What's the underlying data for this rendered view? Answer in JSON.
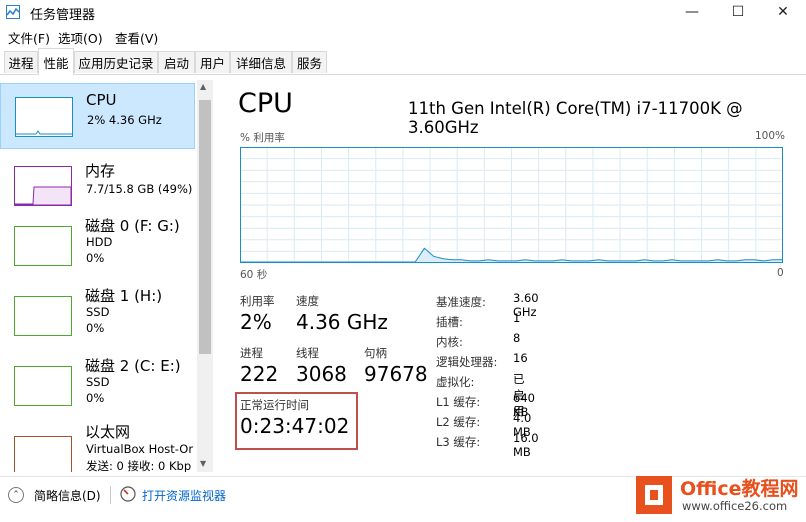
{
  "window": {
    "title": "任务管理器"
  },
  "menu": {
    "file": "文件(F)",
    "options": "选项(O)",
    "view": "查看(V)"
  },
  "tabs": [
    {
      "label": "进程"
    },
    {
      "label": "性能"
    },
    {
      "label": "应用历史记录"
    },
    {
      "label": "启动"
    },
    {
      "label": "用户"
    },
    {
      "label": "详细信息"
    },
    {
      "label": "服务"
    }
  ],
  "sidebar": {
    "items": [
      {
        "title": "CPU",
        "line1": "2% 4.36 GHz",
        "line2": ""
      },
      {
        "title": "内存",
        "line1": "7.7/15.8 GB (49%)",
        "line2": ""
      },
      {
        "title": "磁盘 0 (F: G:)",
        "line1": "HDD",
        "line2": "0%"
      },
      {
        "title": "磁盘 1 (H:)",
        "line1": "SSD",
        "line2": "0%"
      },
      {
        "title": "磁盘 2 (C: E:)",
        "line1": "SSD",
        "line2": "0%"
      },
      {
        "title": "以太网",
        "line1": "VirtualBox Host-Or",
        "line2": "发送: 0 接收: 0 Kbp"
      }
    ]
  },
  "main": {
    "title": "CPU",
    "model": "11th Gen Intel(R) Core(TM) i7-11700K @ 3.60GHz",
    "graph": {
      "ylabel": "% 利用率",
      "ymax": "100%",
      "xleft": "60 秒",
      "xright": "0",
      "utilization_pct": [
        0,
        0,
        0,
        0,
        0,
        0,
        0,
        0,
        0,
        0,
        0,
        0,
        0,
        0,
        0,
        0,
        0,
        0,
        0,
        0,
        0,
        0,
        0,
        0,
        0,
        0,
        0,
        0,
        0,
        0,
        0,
        0,
        0,
        0,
        0,
        0,
        0,
        0,
        0,
        0,
        0,
        0,
        0,
        0,
        0,
        0,
        0,
        0,
        0,
        0,
        0,
        0,
        0,
        0,
        0,
        0,
        0,
        0,
        0,
        0
      ]
    },
    "stats": {
      "util_label": "利用率",
      "util_value": "2%",
      "speed_label": "速度",
      "speed_value": "4.36 GHz",
      "proc_label": "进程",
      "proc_value": "222",
      "thread_label": "线程",
      "thread_value": "3068",
      "handle_label": "句柄",
      "handle_value": "97678",
      "uptime_label": "正常运行时间",
      "uptime_value": "0:23:47:02"
    },
    "details": [
      {
        "k": "基准速度:",
        "v": "3.60 GHz"
      },
      {
        "k": "插槽:",
        "v": "1"
      },
      {
        "k": "内核:",
        "v": "8"
      },
      {
        "k": "逻辑处理器:",
        "v": "16"
      },
      {
        "k": "虚拟化:",
        "v": "已启用"
      },
      {
        "k": "L1 缓存:",
        "v": "640 KB"
      },
      {
        "k": "L2 缓存:",
        "v": "4.0 MB"
      },
      {
        "k": "L3 缓存:",
        "v": "16.0 MB"
      }
    ]
  },
  "bottom": {
    "summary": "简略信息(D)",
    "resmon": "打开资源监视器"
  },
  "watermark": {
    "brand": "Office教程网",
    "url": "www.office26.com"
  },
  "colors": {
    "cpu": "#1a8ec6",
    "mem": "#8b2aa6",
    "disk": "#4ea72e",
    "eth": "#a0522d",
    "highlight": "#c0504d"
  }
}
